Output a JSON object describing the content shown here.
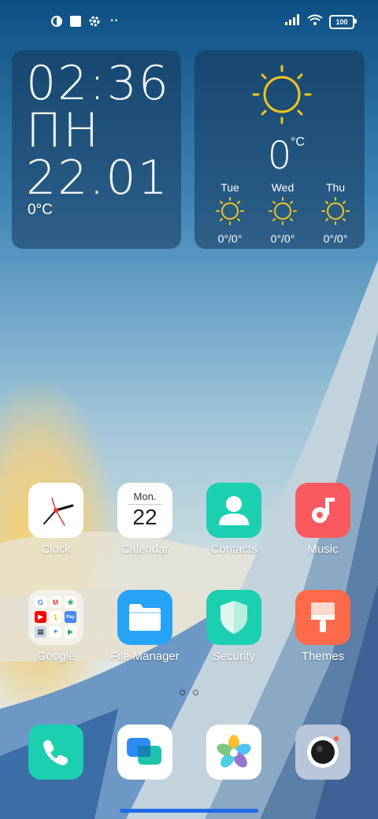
{
  "status_bar": {
    "left_icons": [
      "brand-notification-icon",
      "square-notification-icon",
      "gear-icon",
      "more-dots-icon"
    ],
    "more_text": "··",
    "battery": "100"
  },
  "clock_widget": {
    "time": "02:36",
    "weekday": "ПН",
    "date": "22.01",
    "temperature": "0°C"
  },
  "weather_widget": {
    "current_temp": "0",
    "unit": "°C",
    "forecast": [
      {
        "day": "Tue",
        "temp": "0°/0°"
      },
      {
        "day": "Wed",
        "temp": "0°/0°"
      },
      {
        "day": "Thu",
        "temp": "0°/0°"
      }
    ],
    "sun_color": "#f5c518"
  },
  "apps": [
    {
      "label": "Clock"
    },
    {
      "label": "Calendar",
      "month": "Mon.",
      "day": "22"
    },
    {
      "label": "Contacts"
    },
    {
      "label": "Music"
    },
    {
      "label": "Google"
    },
    {
      "label": "File Manager"
    },
    {
      "label": "Security"
    },
    {
      "label": "Themes"
    }
  ],
  "folder_icons": [
    "G",
    "M",
    "◉",
    "▶",
    "1",
    "Pay",
    "▦",
    "✦",
    "▶"
  ],
  "dock": [
    "phone-icon",
    "messages-icon",
    "gallery-icon",
    "camera-icon"
  ],
  "colors": {
    "accent_green": "#1ccfb0",
    "music_red": "#fa5a5f",
    "file_blue": "#27a3f5",
    "themes_orange": "#ff6b4a",
    "home_bar": "#1e6bea"
  }
}
